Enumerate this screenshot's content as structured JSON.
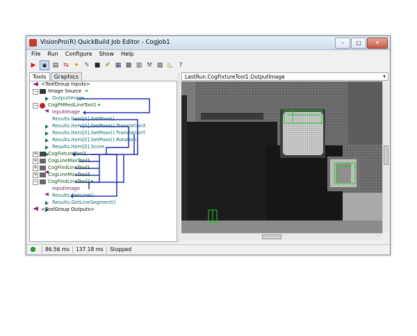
{
  "window": {
    "title": "VisionPro(R) QuickBuild Job Editor - CogJob1",
    "buttons": {
      "minimize": "–",
      "maximize": "□",
      "close": "✕"
    }
  },
  "menu": [
    "File",
    "Run",
    "Configure",
    "Show",
    "Help"
  ],
  "toolbar_icons": [
    "run-once-icon",
    "run-continuous-icon",
    "show-image-icon",
    "reset-icon",
    "wand-icon",
    "tool-icon",
    "stop-icon",
    "notes-icon",
    "image-icon",
    "grid-icon",
    "records-icon",
    "settings-icon",
    "job-icon",
    "measure-icon",
    "help-icon"
  ],
  "tabs": {
    "tools": "Tools",
    "graphics": "Graphics"
  },
  "tree": {
    "group_inputs": "<ToolGroup Inputs>",
    "image_source": "Image Source",
    "output_image": "OutputImage",
    "pmred_tool": "CogPMRedLineTool1",
    "input_image": "InputImage",
    "results": [
      "Results.Item[0].GetPose()",
      "Results.Item[0].GetPose().TranslationX",
      "Results.Item[0].GetPose().TranslationY",
      "Results.Item[0].GetPose().Rotation",
      "Results.Item[0].Score"
    ],
    "fixture_tool": "CogFixtureTool1",
    "linemax1": "CogLineMaxTool1",
    "findline1": "CogFindLineTool1",
    "linemax3": "CogLineMaxTool3",
    "findline2": "CogFindLineTool2",
    "input_image2": "InputImage",
    "get_line": "Results.GetLine()",
    "get_line_segment": "Results.GetLineSegment()",
    "group_outputs": "<ToolGroup Outputs>"
  },
  "image_selector": {
    "value": "LastRun.CogFixtureTool1.OutputImage"
  },
  "status": {
    "time1": "86.56 ms",
    "time2": "137.18 ms",
    "state": "Stopped"
  },
  "colors": {
    "connector": "#1f2fb8",
    "overlay": "#22cc22"
  }
}
